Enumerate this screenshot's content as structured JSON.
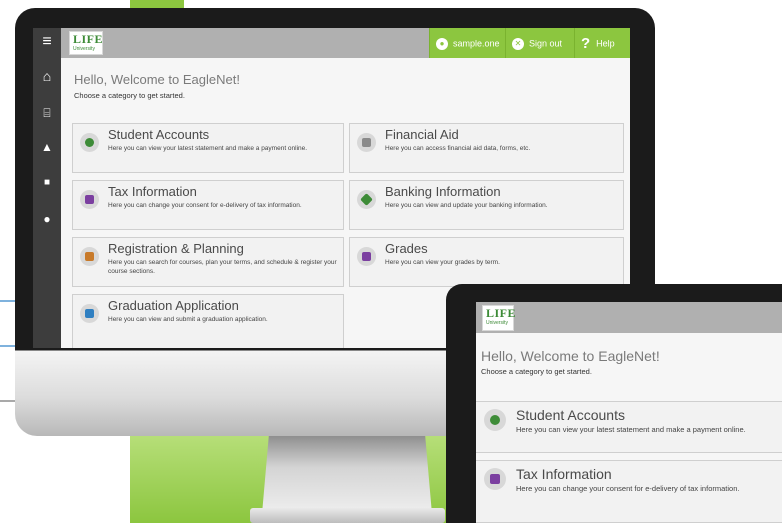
{
  "colors": {
    "brand_green": "#8cc63f",
    "nav_dark": "#3d3d3d",
    "topbar_gray": "#b0b0b0"
  },
  "logo": {
    "word": "LIFE",
    "sub": "University"
  },
  "leftnav": [
    {
      "icon": "menu-icon",
      "glyph": "≡"
    },
    {
      "icon": "home-icon",
      "glyph": "⌂"
    },
    {
      "icon": "bank-icon",
      "glyph": "⌸"
    },
    {
      "icon": "graduation-cap-icon",
      "glyph": "▲"
    },
    {
      "icon": "book-icon",
      "glyph": "■"
    },
    {
      "icon": "user-icon",
      "glyph": "●"
    }
  ],
  "topbar": {
    "user": "sample.one",
    "signout": "Sign out",
    "help": "Help"
  },
  "welcome": {
    "title": "Hello, Welcome to EagleNet!",
    "subtitle": "Choose a category to get started."
  },
  "cards": [
    {
      "title": "Student Accounts",
      "desc": "Here you can view your latest statement and make a payment online.",
      "icon": "dollar-icon",
      "color": "#3d8b37"
    },
    {
      "title": "Financial Aid",
      "desc": "Here you can access financial aid data, forms, etc.",
      "icon": "money-icon",
      "color": "#8a8a8a"
    },
    {
      "title": "Tax Information",
      "desc": "Here you can change your consent for e-delivery of tax information.",
      "icon": "tax-document-icon",
      "color": "#7b3fa0"
    },
    {
      "title": "Banking Information",
      "desc": "Here you can view and update your banking information.",
      "icon": "banking-icon",
      "color": "#3d8b37"
    },
    {
      "title": "Registration & Planning",
      "desc": "Here you can search for courses, plan your terms, and schedule & register your course sections.",
      "icon": "calendar-icon",
      "color": "#c87a2a"
    },
    {
      "title": "Grades",
      "desc": "Here you can view your grades by term.",
      "icon": "grades-icon",
      "color": "#7b3fa0"
    },
    {
      "title": "Graduation Application",
      "desc": "Here you can view and submit a graduation application.",
      "icon": "graduation-icon",
      "color": "#2f7fc1"
    }
  ]
}
